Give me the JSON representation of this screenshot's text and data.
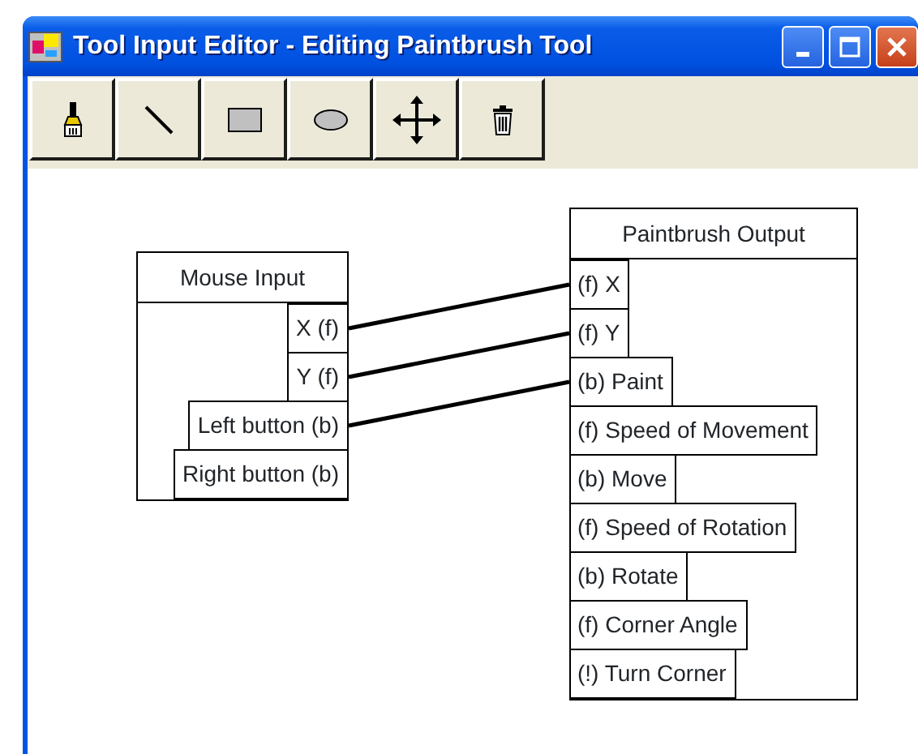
{
  "window": {
    "title": "Tool Input Editor - Editing Paintbrush Tool"
  },
  "toolbar": [
    {
      "kind": "brush"
    },
    {
      "kind": "line"
    },
    {
      "kind": "rectangle"
    },
    {
      "kind": "ellipse"
    },
    {
      "kind": "move"
    },
    {
      "kind": "delete"
    }
  ],
  "input_node": {
    "title": "Mouse Input",
    "ports": [
      {
        "label": "X (f)",
        "connected": true
      },
      {
        "label": "Y (f)",
        "connected": true
      },
      {
        "label": "Left button (b)",
        "connected": true
      },
      {
        "label": "Right button (b)",
        "connected": false
      }
    ]
  },
  "output_node": {
    "title": "Paintbrush Output",
    "ports": [
      {
        "label": "(f) X",
        "connected": true
      },
      {
        "label": "(f) Y",
        "connected": true
      },
      {
        "label": "(b) Paint",
        "connected": true
      },
      {
        "label": "(f) Speed of Movement",
        "connected": false
      },
      {
        "label": "(b) Move",
        "connected": false
      },
      {
        "label": "(f) Speed of Rotation",
        "connected": false
      },
      {
        "label": "(b) Rotate",
        "connected": false
      },
      {
        "label": "(f) Corner Angle",
        "connected": false
      },
      {
        "label": "(!) Turn Corner",
        "connected": false
      }
    ]
  }
}
